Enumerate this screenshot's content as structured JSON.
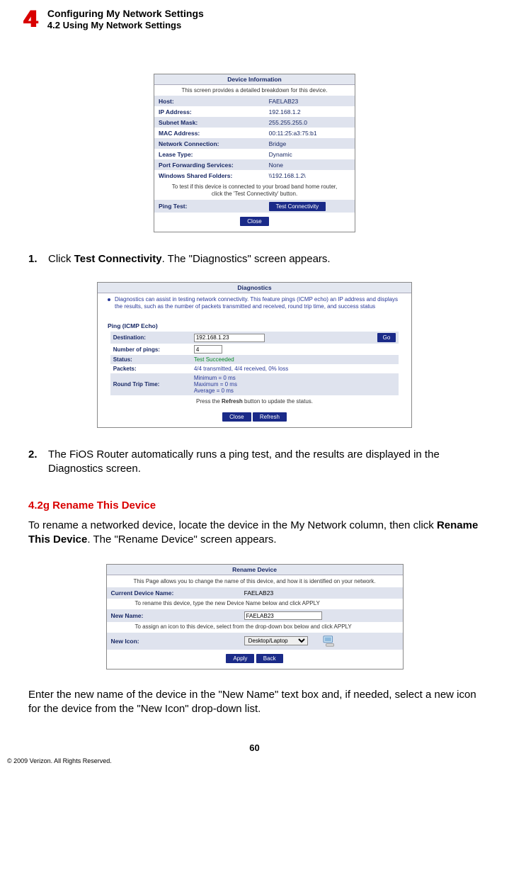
{
  "header": {
    "chapter_num": "4",
    "title1": "Configuring My Network Settings",
    "title2": "4.2  Using My Network Settings"
  },
  "device_info": {
    "panel_title": "Device Information",
    "subtitle": "This screen provides a detailed breakdown for this device.",
    "rows": [
      {
        "label": "Host:",
        "value": "FAELAB23"
      },
      {
        "label": "IP Address:",
        "value": "192.168.1.2"
      },
      {
        "label": "Subnet Mask:",
        "value": "255.255.255.0"
      },
      {
        "label": "MAC Address:",
        "value": "00:11:25:a3:75:b1"
      },
      {
        "label": "Network Connection:",
        "value": "Bridge"
      },
      {
        "label": "Lease Type:",
        "value": "Dynamic"
      },
      {
        "label": "Port Forwarding Services:",
        "value": "None"
      },
      {
        "label": "Windows Shared Folders:",
        "value": "\\\\192.168.1.2\\"
      }
    ],
    "note": "To test if this device is connected to your broad band home router, click the 'Test Connectivity' button.",
    "ping_label": "Ping Test:",
    "test_btn": "Test Connectivity",
    "close_btn": "Close"
  },
  "step1": {
    "num": "1.",
    "text_pre": "Click ",
    "text_bold": "Test Connectivity",
    "text_post": ". The \"Diagnostics\" screen appears."
  },
  "diagnostics": {
    "panel_title": "Diagnostics",
    "bullet": "Diagnostics can assist in testing network connectivity. This feature pings (ICMP echo) an IP address and displays the results, such as the number of packets transmitted and received, round trip time, and success status",
    "section_label": "Ping (ICMP Echo)",
    "dest_label": "Destination:",
    "dest_value": "192.168.1.23",
    "go_btn": "Go",
    "num_pings_label": "Number of pings:",
    "num_pings_value": "4",
    "status_label": "Status:",
    "status_value": "Test Succeeded",
    "packets_label": "Packets:",
    "packets_value": "4/4 transmitted, 4/4 received, 0% loss",
    "rtt_label": "Round Trip Time:",
    "rtt_lines": [
      "Minimum = 0 ms",
      "Maximum = 0 ms",
      "Average = 0 ms"
    ],
    "refresh_note_pre": "Press the ",
    "refresh_note_bold": "Refresh",
    "refresh_note_post": " button to update the status.",
    "close_btn": "Close",
    "refresh_btn": "Refresh"
  },
  "step2": {
    "num": "2.",
    "text": "The FiOS Router automatically runs a ping test, and the results are displayed in the Diagnostics screen."
  },
  "subsection": "4.2g  Rename This Device",
  "rename_intro_pre": "To rename a networked device, locate the device in the My Network column, then click ",
  "rename_intro_bold": "Rename This Device",
  "rename_intro_post": ". The \"Rename Device\" screen appears.",
  "rename_panel": {
    "title": "Rename Device",
    "sub": "This Page allows you to change the name of this device, and how it is identified on your network.",
    "current_label": "Current Device Name:",
    "current_value": "FAELAB23",
    "note1": "To rename this device, type the new Device Name below and click APPLY",
    "new_name_label": "New Name:",
    "new_name_value": "FAELAB23",
    "note2": "To assign an icon to this device, select from the drop-down box below and click APPLY",
    "new_icon_label": "New Icon:",
    "new_icon_value": "Desktop/Laptop",
    "apply_btn": "Apply",
    "back_btn": "Back"
  },
  "rename_outro": "Enter the new name of the device in the \"New Name\" text box and, if needed, select a new icon for the device from the \"New Icon\" drop-down list.",
  "page_num": "60",
  "copyright": "© 2009 Verizon. All Rights Reserved."
}
